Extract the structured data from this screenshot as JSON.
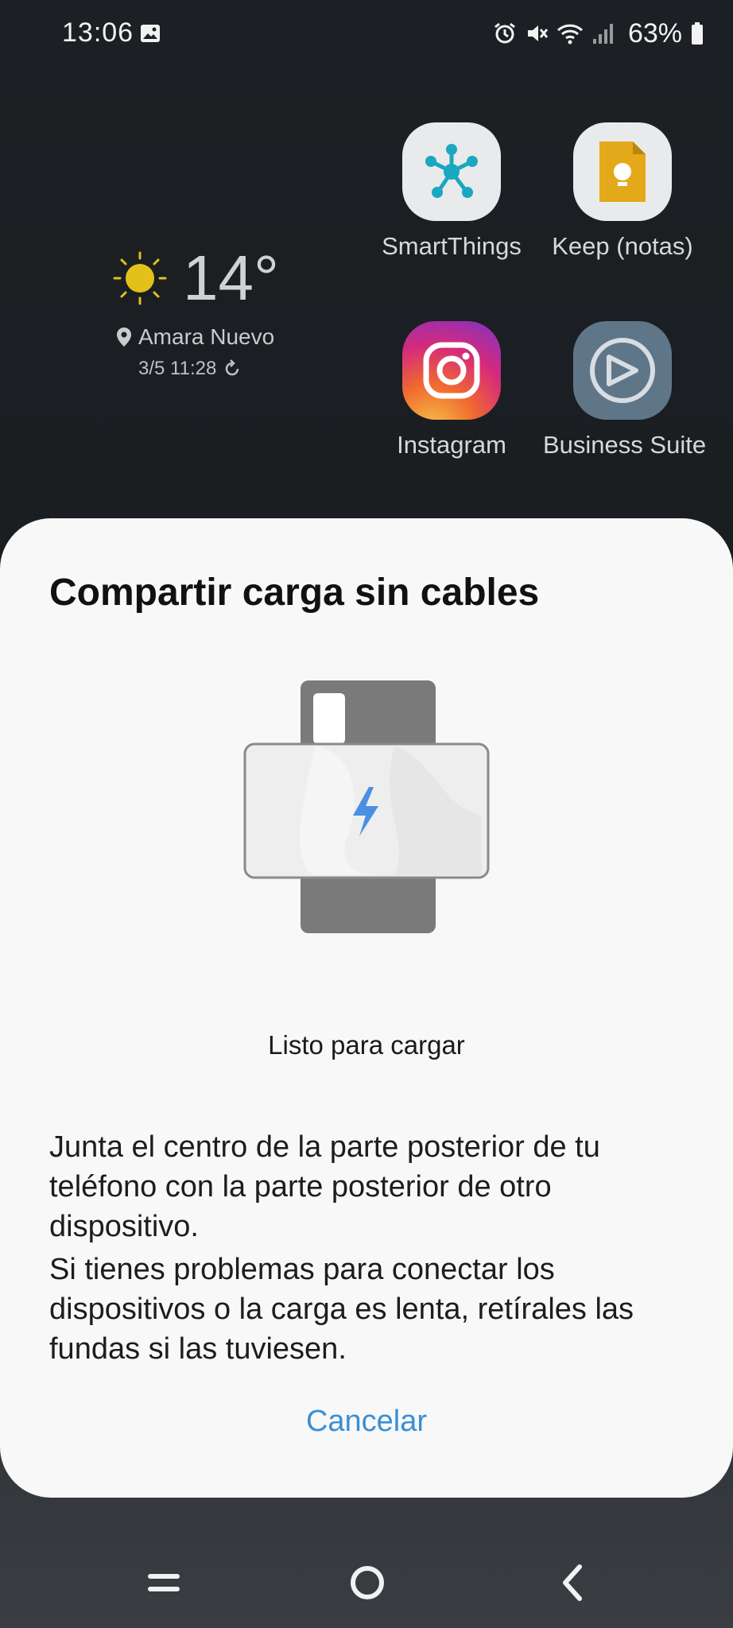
{
  "status_bar": {
    "time": "13:06",
    "battery": "63%",
    "icons": [
      "gallery-icon",
      "alarm-icon",
      "mute-icon",
      "wifi-icon",
      "signal-icon",
      "battery-icon"
    ]
  },
  "weather": {
    "temperature": "14°",
    "location": "Amara Nuevo",
    "updated": "3/5 11:28",
    "icon": "sun-icon"
  },
  "apps": [
    {
      "label": "SmartThings",
      "icon": "smartthings-icon"
    },
    {
      "label": "Keep (notas)",
      "icon": "keep-icon"
    },
    {
      "label": "Instagram",
      "icon": "instagram-icon"
    },
    {
      "label": "Business Suite",
      "icon": "business-suite-icon"
    }
  ],
  "dialog": {
    "title": "Compartir carga sin cables",
    "status": "Listo para cargar",
    "paragraph1": "Junta el centro de la parte posterior de tu teléfono con la parte posterior de otro dispositivo.",
    "paragraph2": "Si tienes problemas para conectar los dispositivos o la carga es lenta, retírales las fundas si las tuviesen.",
    "cancel_label": "Cancelar"
  },
  "colors": {
    "accent": "#3b8fd3",
    "dialog_bg": "#f8f8f8",
    "bolt": "#4a90e2"
  },
  "nav_bar": {
    "icons": [
      "recents-icon",
      "home-icon",
      "back-icon"
    ]
  }
}
